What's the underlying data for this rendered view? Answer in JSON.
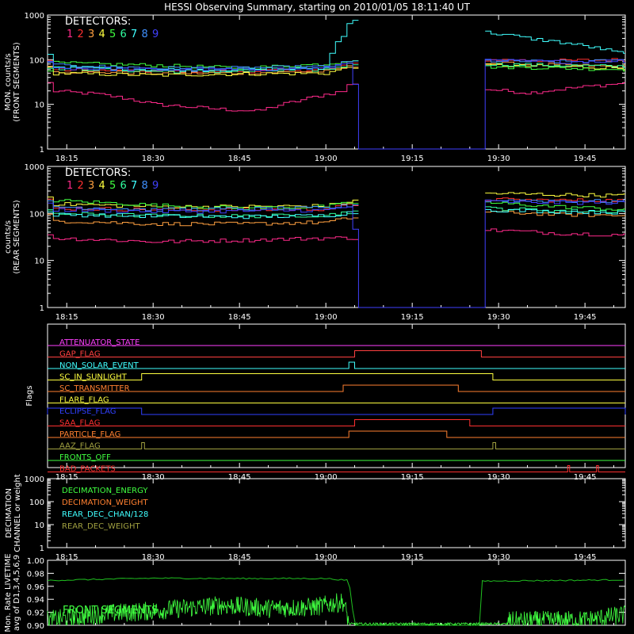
{
  "title": "HESSI Observing Summary, starting on 2010/01/05 18:11:40 UT",
  "time_ticks": [
    "18:15",
    "18:30",
    "18:45",
    "19:00",
    "19:15",
    "19:30",
    "19:45"
  ],
  "detectors_label": "DETECTORS:",
  "detector_colors": [
    "#ff2a8a",
    "#ff3030",
    "#ffa040",
    "#ffff40",
    "#40ff40",
    "#30ffa0",
    "#40ffff",
    "#4090ff",
    "#4040ff"
  ],
  "chart_data": [
    {
      "type": "line",
      "title": "",
      "ylabel": "MON. counts/s",
      "ylabel2": "(FRONT SEGMENTS)",
      "yscale": "log",
      "ylim": [
        1,
        1000
      ],
      "ytick_labels": [
        "1",
        "10",
        "100",
        "1000"
      ],
      "xlim": [
        "18:11:40",
        "19:52:00"
      ],
      "legend": [
        "1",
        "2",
        "3",
        "4",
        "5",
        "6",
        "7",
        "8",
        "9"
      ],
      "legend_colors": [
        "#ff2a8a",
        "#ff3030",
        "#ffa040",
        "#ffff40",
        "#40ff40",
        "#30ffa0",
        "#40ffff",
        "#4090ff",
        "#4040ff"
      ],
      "gap": [
        "19:05",
        "19:27"
      ],
      "series": [
        {
          "name": "1",
          "color": "#ff2a8a",
          "points": [
            [
              "18:12",
              20
            ],
            [
              "18:20",
              17
            ],
            [
              "18:30",
              10
            ],
            [
              "18:40",
              8
            ],
            [
              "18:48",
              7
            ],
            [
              "18:55",
              12
            ],
            [
              "19:03",
              20
            ],
            [
              "19:04",
              30
            ],
            [
              "19:27",
              22
            ],
            [
              "19:35",
              18
            ],
            [
              "19:45",
              25
            ],
            [
              "19:52",
              30
            ]
          ]
        },
        {
          "name": "2",
          "color": "#ff3030",
          "points": [
            [
              "18:12",
              60
            ],
            [
              "18:30",
              55
            ],
            [
              "18:45",
              55
            ],
            [
              "19:00",
              60
            ],
            [
              "19:04",
              80
            ],
            [
              "19:27",
              100
            ],
            [
              "19:40",
              95
            ],
            [
              "19:52",
              100
            ]
          ]
        },
        {
          "name": "3",
          "color": "#ffa040",
          "points": [
            [
              "18:12",
              55
            ],
            [
              "18:30",
              50
            ],
            [
              "18:45",
              50
            ],
            [
              "19:00",
              55
            ],
            [
              "19:04",
              70
            ],
            [
              "19:27",
              85
            ],
            [
              "19:40",
              75
            ],
            [
              "19:52",
              70
            ]
          ]
        },
        {
          "name": "4",
          "color": "#ffff40",
          "points": [
            [
              "18:12",
              50
            ],
            [
              "18:30",
              45
            ],
            [
              "18:45",
              48
            ],
            [
              "19:00",
              50
            ],
            [
              "19:04",
              70
            ],
            [
              "19:27",
              75
            ],
            [
              "19:40",
              70
            ],
            [
              "19:52",
              65
            ]
          ]
        },
        {
          "name": "5",
          "color": "#40ff40",
          "points": [
            [
              "18:12",
              85
            ],
            [
              "18:30",
              75
            ],
            [
              "18:45",
              65
            ],
            [
              "19:00",
              80
            ],
            [
              "19:04",
              100
            ],
            [
              "19:27",
              70
            ],
            [
              "19:40",
              65
            ],
            [
              "19:52",
              60
            ]
          ]
        },
        {
          "name": "6",
          "color": "#30ffa0",
          "points": [
            [
              "18:12",
              65
            ],
            [
              "18:30",
              55
            ],
            [
              "18:45",
              55
            ],
            [
              "19:00",
              60
            ],
            [
              "19:04",
              80
            ],
            [
              "19:27",
              80
            ],
            [
              "19:40",
              75
            ],
            [
              "19:52",
              70
            ]
          ]
        },
        {
          "name": "7",
          "color": "#40ffff",
          "points": [
            [
              "18:12",
              70
            ],
            [
              "18:30",
              60
            ],
            [
              "18:45",
              60
            ],
            [
              "19:00",
              65
            ],
            [
              "19:03",
              400
            ],
            [
              "19:04",
              800
            ],
            [
              "19:27",
              420
            ],
            [
              "19:35",
              300
            ],
            [
              "19:45",
              200
            ],
            [
              "19:52",
              130
            ]
          ]
        },
        {
          "name": "8",
          "color": "#4090ff",
          "points": [
            [
              "18:12",
              75
            ],
            [
              "18:30",
              65
            ],
            [
              "18:45",
              65
            ],
            [
              "19:00",
              70
            ],
            [
              "19:04",
              90
            ],
            [
              "19:27",
              95
            ],
            [
              "19:40",
              90
            ],
            [
              "19:52",
              95
            ]
          ]
        },
        {
          "name": "9",
          "color": "#4040ff",
          "points": [
            [
              "18:12",
              65
            ],
            [
              "18:30",
              60
            ],
            [
              "18:45",
              60
            ],
            [
              "19:00",
              65
            ],
            [
              "19:04",
              90
            ],
            [
              "19:05",
              1
            ],
            [
              "19:27",
              1
            ],
            [
              "19:27",
              95
            ],
            [
              "19:40",
              90
            ],
            [
              "19:52",
              95
            ]
          ]
        }
      ]
    },
    {
      "type": "line",
      "title": "",
      "ylabel": "counts/s",
      "ylabel2": "(REAR SEGMENTS)",
      "yscale": "log",
      "ylim": [
        1,
        1000
      ],
      "ytick_labels": [
        "1",
        "10",
        "100",
        "1000"
      ],
      "xlim": [
        "18:11:40",
        "19:52:00"
      ],
      "legend": [
        "1",
        "2",
        "3",
        "4",
        "5",
        "6",
        "7",
        "8",
        "9"
      ],
      "legend_colors": [
        "#ff2a8a",
        "#ff3030",
        "#ffa040",
        "#ffff40",
        "#40ff40",
        "#30ffa0",
        "#40ffff",
        "#4090ff",
        "#4040ff"
      ],
      "gap": [
        "19:05",
        "19:27"
      ],
      "series": [
        {
          "name": "1",
          "color": "#ff2a8a",
          "points": [
            [
              "18:12",
              30
            ],
            [
              "18:30",
              25
            ],
            [
              "18:45",
              27
            ],
            [
              "19:00",
              30
            ],
            [
              "19:04",
              30
            ],
            [
              "19:27",
              45
            ],
            [
              "19:40",
              38
            ],
            [
              "19:52",
              35
            ]
          ]
        },
        {
          "name": "2",
          "color": "#ff3030",
          "points": [
            [
              "18:12",
              130
            ],
            [
              "18:30",
              120
            ],
            [
              "18:45",
              120
            ],
            [
              "19:00",
              125
            ],
            [
              "19:04",
              150
            ],
            [
              "19:27",
              200
            ],
            [
              "19:40",
              190
            ],
            [
              "19:52",
              190
            ]
          ]
        },
        {
          "name": "3",
          "color": "#ffa040",
          "points": [
            [
              "18:12",
              70
            ],
            [
              "18:30",
              60
            ],
            [
              "18:45",
              60
            ],
            [
              "19:00",
              65
            ],
            [
              "19:04",
              80
            ],
            [
              "19:27",
              110
            ],
            [
              "19:40",
              95
            ],
            [
              "19:52",
              90
            ]
          ]
        },
        {
          "name": "4",
          "color": "#ffff40",
          "points": [
            [
              "18:12",
              160
            ],
            [
              "18:30",
              140
            ],
            [
              "18:45",
              140
            ],
            [
              "19:00",
              145
            ],
            [
              "19:04",
              180
            ],
            [
              "19:27",
              270
            ],
            [
              "19:40",
              250
            ],
            [
              "19:52",
              240
            ]
          ]
        },
        {
          "name": "5",
          "color": "#40ff40",
          "points": [
            [
              "18:12",
              190
            ],
            [
              "18:30",
              150
            ],
            [
              "18:45",
              130
            ],
            [
              "19:00",
              140
            ],
            [
              "19:04",
              170
            ],
            [
              "19:27",
              170
            ],
            [
              "19:40",
              140
            ],
            [
              "19:52",
              120
            ]
          ]
        },
        {
          "name": "6",
          "color": "#30ffa0",
          "points": [
            [
              "18:12",
              100
            ],
            [
              "18:30",
              90
            ],
            [
              "18:45",
              88
            ],
            [
              "19:00",
              92
            ],
            [
              "19:04",
              110
            ],
            [
              "19:27",
              130
            ],
            [
              "19:40",
              115
            ],
            [
              "19:52",
              110
            ]
          ]
        },
        {
          "name": "7",
          "color": "#40ffff",
          "points": [
            [
              "18:12",
              95
            ],
            [
              "18:30",
              88
            ],
            [
              "18:45",
              85
            ],
            [
              "19:00",
              90
            ],
            [
              "19:04",
              105
            ],
            [
              "19:27",
              120
            ],
            [
              "19:40",
              110
            ],
            [
              "19:52",
              105
            ]
          ]
        },
        {
          "name": "8",
          "color": "#4090ff",
          "points": [
            [
              "18:12",
              140
            ],
            [
              "18:30",
              120
            ],
            [
              "18:45",
              125
            ],
            [
              "19:00",
              130
            ],
            [
              "19:04",
              150
            ],
            [
              "19:27",
              190
            ],
            [
              "19:40",
              185
            ],
            [
              "19:52",
              180
            ]
          ]
        },
        {
          "name": "9",
          "color": "#4040ff",
          "points": [
            [
              "18:12",
              120
            ],
            [
              "18:30",
              110
            ],
            [
              "18:45",
              112
            ],
            [
              "19:00",
              118
            ],
            [
              "19:04",
              140
            ],
            [
              "19:05",
              1
            ],
            [
              "19:27",
              1
            ],
            [
              "19:27",
              180
            ],
            [
              "19:40",
              170
            ],
            [
              "19:52",
              170
            ]
          ]
        }
      ]
    },
    {
      "type": "line",
      "title": "",
      "ylabel": "Flags",
      "xlim": [
        "18:11:40",
        "19:52:00"
      ],
      "flags": [
        {
          "name": "ATTENUATOR_STATE",
          "color": "#ff40ff",
          "on": []
        },
        {
          "name": "GAP_FLAG",
          "color": "#ff4040",
          "on": [
            [
              "19:05",
              "19:27"
            ]
          ]
        },
        {
          "name": "NON_SOLAR_EVENT",
          "color": "#40ffff",
          "on": [
            [
              "19:04",
              "19:05"
            ]
          ]
        },
        {
          "name": "SC_IN_SUNLIGHT",
          "color": "#ffff40",
          "on": [
            [
              "18:28",
              "19:29"
            ]
          ]
        },
        {
          "name": "SC_TRANSMITTER",
          "color": "#ff8030",
          "on": [
            [
              "19:03",
              "19:23"
            ]
          ]
        },
        {
          "name": "FLARE_FLAG",
          "color": "#ffff40",
          "on": []
        },
        {
          "name": "ECLIPSE_FLAG",
          "color": "#3040ff",
          "on": [
            [
              "18:11:40",
              "18:28"
            ],
            [
              "19:29",
              "19:52"
            ]
          ]
        },
        {
          "name": "SAA_FLAG",
          "color": "#ff3030",
          "on": [
            [
              "19:05",
              "19:25"
            ]
          ]
        },
        {
          "name": "PARTICLE_FLAG",
          "color": "#ff8030",
          "on": [
            [
              "19:04",
              "19:21"
            ]
          ]
        },
        {
          "name": "AAZ_FLAG",
          "color": "#a0a040",
          "on": [
            [
              "18:28",
              "18:28:30"
            ],
            [
              "19:29",
              "19:29:30"
            ]
          ]
        },
        {
          "name": "FRONTS_OFF",
          "color": "#40ff40",
          "on": []
        },
        {
          "name": "BAD_PACKETS",
          "color": "#ff3030",
          "on": [
            [
              "19:42",
              "19:42:20"
            ],
            [
              "19:47",
              "19:47:20"
            ]
          ]
        }
      ]
    },
    {
      "type": "line",
      "title": "",
      "ylabel": "DECIMATION",
      "ylabel2": "CHANNEL or weight",
      "yscale": "log",
      "ylim": [
        1,
        1000
      ],
      "ytick_labels": [
        "1",
        "10",
        "100",
        "1000"
      ],
      "xlim": [
        "18:11:40",
        "19:52:00"
      ],
      "legend": [
        "DECIMATION_ENERGY",
        "DECIMATION_WEIGHT",
        "REAR_DEC_CHAN/128",
        "REAR_DEC_WEIGHT"
      ],
      "legend_colors": [
        "#40ff40",
        "#ff8030",
        "#40ffff",
        "#a0a040"
      ],
      "series": []
    },
    {
      "type": "line",
      "title": "",
      "ylabel": "Mon. Rate LIVETIME",
      "ylabel2": "avg of D1,3,4,5,6,9",
      "ylim": [
        0.9,
        1.0
      ],
      "ytick_labels": [
        "0.90",
        "0.92",
        "0.94",
        "0.96",
        "0.98",
        "1.00"
      ],
      "xlim": [
        "18:11:40",
        "19:52:00"
      ],
      "annotation": "FRONT SEGMENTS",
      "series": [
        {
          "name": "",
          "color": "#20c020",
          "points": [
            [
              "18:11:40",
              0.969
            ],
            [
              "18:30",
              0.9725
            ],
            [
              "18:45",
              0.972
            ],
            [
              "19:00",
              0.972
            ],
            [
              "19:04",
              0.969
            ],
            [
              "19:05",
              0.9
            ],
            [
              "19:27",
              0.9
            ],
            [
              "19:27",
              0.968
            ],
            [
              "19:40",
              0.969
            ],
            [
              "19:52",
              0.97
            ]
          ]
        },
        {
          "name": "",
          "color": "#40ff40",
          "points": [
            [
              "18:11:40",
              0.902
            ],
            [
              "18:15",
              0.905
            ],
            [
              "18:22",
              0.912
            ],
            [
              "18:28",
              0.915
            ],
            [
              "18:35",
              0.92
            ],
            [
              "18:42",
              0.925
            ],
            [
              "18:50",
              0.92
            ],
            [
              "18:58",
              0.922
            ],
            [
              "19:03",
              0.93
            ],
            [
              "19:04",
              0.9
            ],
            [
              "19:27",
              0.9
            ],
            [
              "19:45",
              0.902
            ],
            [
              "19:52",
              0.91
            ]
          ]
        }
      ]
    }
  ]
}
